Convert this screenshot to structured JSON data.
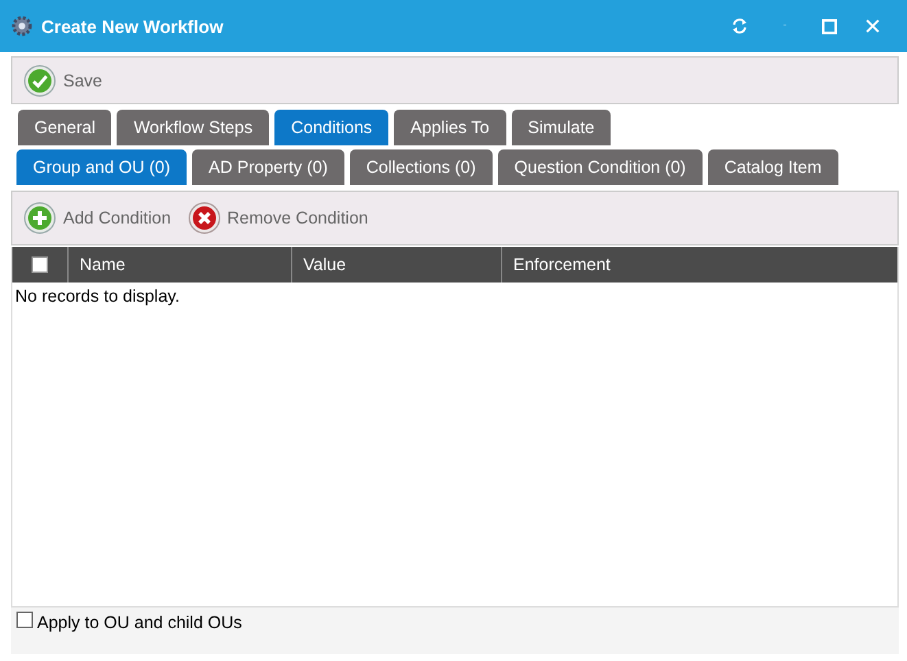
{
  "window": {
    "title": "Create New Workflow"
  },
  "toolbar": {
    "buttons": [
      {
        "label": "Save",
        "kind": "save"
      }
    ]
  },
  "tabs": [
    {
      "label": "General",
      "selected": false
    },
    {
      "label": "Workflow Steps",
      "selected": false
    },
    {
      "label": "Conditions",
      "selected": true
    },
    {
      "label": "Applies To",
      "selected": false
    },
    {
      "label": "Simulate",
      "selected": false
    }
  ],
  "subtabs": [
    {
      "label": "Group and OU (0)",
      "selected": true
    },
    {
      "label": "AD Property (0)",
      "selected": false
    },
    {
      "label": "Collections (0)",
      "selected": false
    },
    {
      "label": "Question Condition (0)",
      "selected": false
    },
    {
      "label": "Catalog Item",
      "selected": false
    }
  ],
  "condition_toolbar": {
    "buttons": [
      {
        "label": "Add Condition",
        "kind": "add"
      },
      {
        "label": "Remove Condition",
        "kind": "remove"
      }
    ]
  },
  "table": {
    "select_all_checked": false,
    "columns": [
      "Name",
      "Value",
      "Enforcement"
    ],
    "empty_message": "No records to display."
  },
  "apply_to_child_ous": {
    "label": "Apply to OU and child OUs",
    "checked": false
  }
}
